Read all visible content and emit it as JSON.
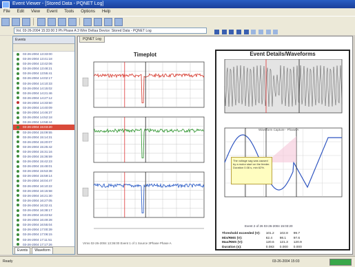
{
  "window": {
    "title": "Event Viewer - [Stored Data - PQNET Log]"
  },
  "menu": [
    "File",
    "Edit",
    "View",
    "Event",
    "Tools",
    "Options",
    "Help"
  ],
  "toolbar": {
    "icons": [
      "open-icon",
      "save-icon",
      "print-icon",
      "copy-icon",
      "zoom-in-icon",
      "zoom-out-icon",
      "chart-icon",
      "table-icon",
      "export-icon",
      "settings-icon",
      "help-icon"
    ]
  },
  "address": {
    "value": "Vol. 03-26-2004 15:33:00 3 Ph Phase A 3 Wire Deltaa Device: Stored Data - PQNET Log"
  },
  "sidebar": {
    "header": "Events",
    "rows": [
      {
        "text": "03-26-2004 13:33:00",
        "state": ""
      },
      {
        "text": "03-26-2004 13:41:18",
        "state": ""
      },
      {
        "text": "03-26-2004 13:42:06",
        "state": ""
      },
      {
        "text": "03-26-2004 13:48:21",
        "state": ""
      },
      {
        "text": "03-26-2004 13:55:41",
        "state": ""
      },
      {
        "text": "03-26-2004 14:02:17",
        "state": ""
      },
      {
        "text": "03-26-2004 14:10:33",
        "state": ""
      },
      {
        "text": "03-26-2004 14:15:02",
        "state": ""
      },
      {
        "text": "03-26-2004 14:21:46",
        "state": ""
      },
      {
        "text": "03-26-2004 14:27:12",
        "state": ""
      },
      {
        "text": "03-26-2004 14:33:50",
        "state": "flag"
      },
      {
        "text": "03-26-2004 14:40:09",
        "state": ""
      },
      {
        "text": "03-26-2004 14:46:37",
        "state": ""
      },
      {
        "text": "03-26-2004 14:52:18",
        "state": ""
      },
      {
        "text": "03-26-2004 14:58:44",
        "state": ""
      },
      {
        "text": "03-26-2004 15:03:20",
        "state": "sel"
      },
      {
        "text": "03-26-2004 15:09:55",
        "state": ""
      },
      {
        "text": "03-26-2004 15:14:31",
        "state": ""
      },
      {
        "text": "03-26-2004 15:20:07",
        "state": ""
      },
      {
        "text": "03-26-2004 15:25:42",
        "state": ""
      },
      {
        "text": "03-26-2004 15:31:16",
        "state": ""
      },
      {
        "text": "03-26-2004 15:36:59",
        "state": ""
      },
      {
        "text": "03-26-2004 15:42:23",
        "state": ""
      },
      {
        "text": "03-26-2004 15:48:01",
        "state": ""
      },
      {
        "text": "03-26-2004 15:53:38",
        "state": ""
      },
      {
        "text": "03-26-2004 15:59:14",
        "state": ""
      },
      {
        "text": "03-26-2004 16:04:47",
        "state": ""
      },
      {
        "text": "03-26-2004 16:10:22",
        "state": ""
      },
      {
        "text": "03-26-2004 16:15:58",
        "state": ""
      },
      {
        "text": "03-26-2004 16:21:30",
        "state": ""
      },
      {
        "text": "03-26-2004 16:27:05",
        "state": ""
      },
      {
        "text": "03-26-2004 16:32:41",
        "state": ""
      },
      {
        "text": "03-26-2004 16:38:17",
        "state": ""
      },
      {
        "text": "03-26-2004 16:43:52",
        "state": ""
      },
      {
        "text": "03-26-2004 16:49:28",
        "state": ""
      },
      {
        "text": "03-26-2004 16:55:04",
        "state": ""
      },
      {
        "text": "03-26-2004 17:00:39",
        "state": ""
      },
      {
        "text": "03-26-2004 17:06:15",
        "state": ""
      },
      {
        "text": "03-26-2004 17:11:51",
        "state": ""
      },
      {
        "text": "03-26-2004 17:17:26",
        "state": ""
      }
    ],
    "tabs": [
      "Events",
      "Waveform"
    ]
  },
  "document": {
    "tab": "PQNET Log"
  },
  "timeplot": {
    "title": "Timeplot",
    "footer": "Vrms 02-26-2004 13:36:00  Event 1 of 1  Source 3Phase  Phase A",
    "charts": [
      {
        "color": "#d9453a",
        "label": "Vrms A"
      },
      {
        "color": "#3a9a3a",
        "label": "Vrms B"
      },
      {
        "color": "#2f5fc8",
        "label": "Vrms C"
      }
    ]
  },
  "event": {
    "title": "Event Details/Waveforms",
    "caption": "Waveform Capture - Phase A",
    "annotation": "The voltage sag was caused by a motor start on the feeder. Duration 0.08 s, min 62%.",
    "summary": "Event 2 of 26 03-26-2004 15:03:20",
    "stats": [
      [
        "Threshold exceeded (V):",
        "101.2",
        "102.8",
        "99.7"
      ],
      [
        "Min/RMS (V):",
        "62.4",
        "98.1",
        "97.6"
      ],
      [
        "Max/RMS (V):",
        "120.6",
        "121.3",
        "120.9"
      ],
      [
        "Duration (s):",
        "0.083",
        "0.000",
        "0.000"
      ]
    ]
  },
  "status": {
    "left": "Ready",
    "right": "03-26-2004 15:03"
  }
}
